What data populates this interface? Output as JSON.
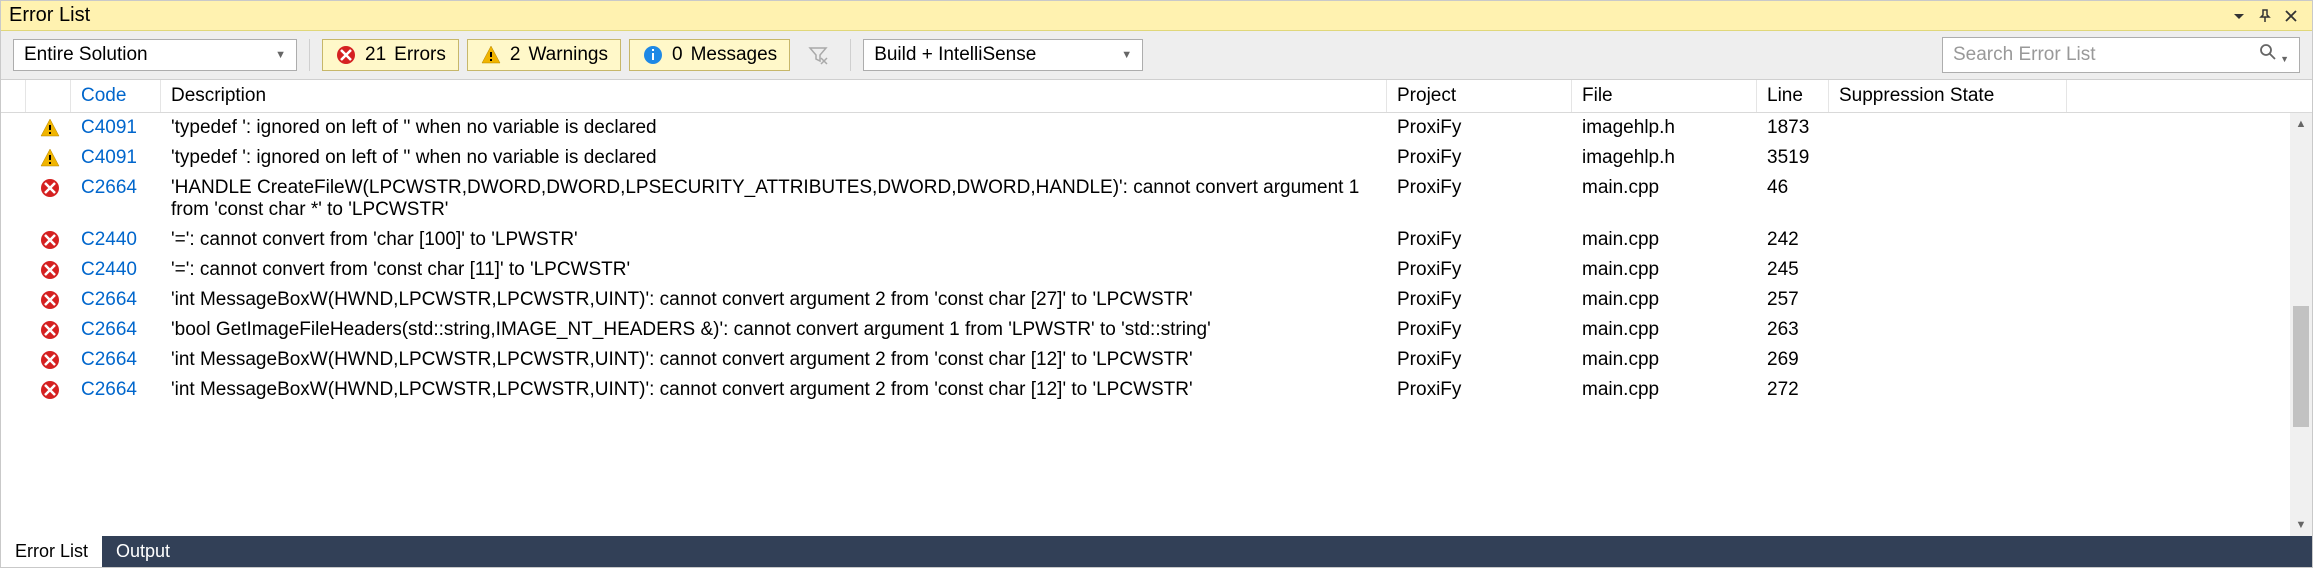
{
  "titlebar": {
    "title": "Error List"
  },
  "toolbar": {
    "scope": "Entire Solution",
    "errors_count": 21,
    "errors_label": "Errors",
    "warnings_count": 2,
    "warnings_label": "Warnings",
    "messages_count": 0,
    "messages_label": "Messages",
    "build_mode": "Build + IntelliSense",
    "search_placeholder": "Search Error List"
  },
  "columns": {
    "code": "Code",
    "description": "Description",
    "project": "Project",
    "file": "File",
    "line": "Line",
    "suppression": "Suppression State"
  },
  "rows": [
    {
      "severity": "warning",
      "code": "C4091",
      "description": "'typedef ': ignored on left of '' when no variable is declared",
      "project": "ProxiFy",
      "file": "imagehlp.h",
      "line": "1873",
      "suppression": ""
    },
    {
      "severity": "warning",
      "code": "C4091",
      "description": "'typedef ': ignored on left of '' when no variable is declared",
      "project": "ProxiFy",
      "file": "imagehlp.h",
      "line": "3519",
      "suppression": ""
    },
    {
      "severity": "error",
      "code": "C2664",
      "description": "'HANDLE CreateFileW(LPCWSTR,DWORD,DWORD,LPSECURITY_ATTRIBUTES,DWORD,DWORD,HANDLE)': cannot convert argument 1 from 'const char *' to 'LPCWSTR'",
      "project": "ProxiFy",
      "file": "main.cpp",
      "line": "46",
      "suppression": ""
    },
    {
      "severity": "error",
      "code": "C2440",
      "description": "'=': cannot convert from 'char [100]' to 'LPWSTR'",
      "project": "ProxiFy",
      "file": "main.cpp",
      "line": "242",
      "suppression": ""
    },
    {
      "severity": "error",
      "code": "C2440",
      "description": "'=': cannot convert from 'const char [11]' to 'LPCWSTR'",
      "project": "ProxiFy",
      "file": "main.cpp",
      "line": "245",
      "suppression": ""
    },
    {
      "severity": "error",
      "code": "C2664",
      "description": "'int MessageBoxW(HWND,LPCWSTR,LPCWSTR,UINT)': cannot convert argument 2 from 'const char [27]' to 'LPCWSTR'",
      "project": "ProxiFy",
      "file": "main.cpp",
      "line": "257",
      "suppression": ""
    },
    {
      "severity": "error",
      "code": "C2664",
      "description": "'bool GetImageFileHeaders(std::string,IMAGE_NT_HEADERS &)': cannot convert argument 1 from 'LPWSTR' to 'std::string'",
      "project": "ProxiFy",
      "file": "main.cpp",
      "line": "263",
      "suppression": ""
    },
    {
      "severity": "error",
      "code": "C2664",
      "description": "'int MessageBoxW(HWND,LPCWSTR,LPCWSTR,UINT)': cannot convert argument 2 from 'const char [12]' to 'LPCWSTR'",
      "project": "ProxiFy",
      "file": "main.cpp",
      "line": "269",
      "suppression": ""
    },
    {
      "severity": "error",
      "code": "C2664",
      "description": "'int MessageBoxW(HWND,LPCWSTR,LPCWSTR,UINT)': cannot convert argument 2 from 'const char [12]' to 'LPCWSTR'",
      "project": "ProxiFy",
      "file": "main.cpp",
      "line": "272",
      "suppression": ""
    }
  ],
  "tabs": {
    "error_list": "Error List",
    "output": "Output"
  }
}
